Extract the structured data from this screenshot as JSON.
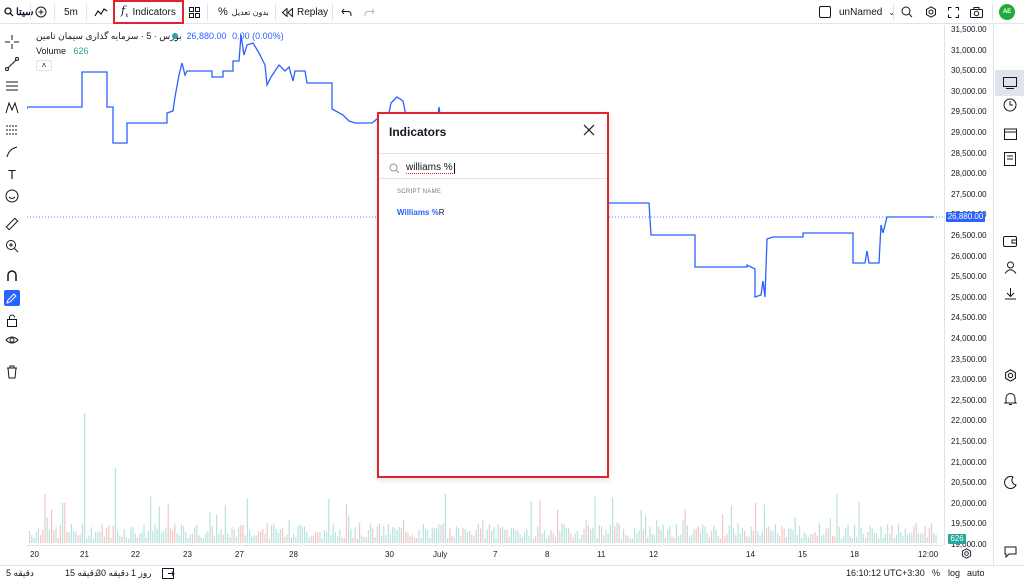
{
  "topbar": {
    "symbol": "سیتا",
    "interval": "5m",
    "indicators_label": "Indicators",
    "adjust_label": "بدون تعدیل",
    "replay_label": "Replay",
    "layout_name": "unNamed",
    "avatar_initials": "AE"
  },
  "legend": {
    "symbol_title": "بورس · 5 · سرمایه گذاری سیمان تامین",
    "price": "26,880.00",
    "change": "0.00 (0.00%)",
    "volume_label": "Volume",
    "volume_value": "626",
    "collapse_icon": "chevron-up-icon"
  },
  "price_axis": {
    "ticks": [
      "31,500.00",
      "31,000.00",
      "30,500.00",
      "30,000.00",
      "29,500.00",
      "29,000.00",
      "28,500.00",
      "28,000.00",
      "27,500.00",
      "27,000.00",
      "26,500.00",
      "26,000.00",
      "25,500.00",
      "25,000.00",
      "24,500.00",
      "24,000.00",
      "23,500.00",
      "23,000.00",
      "22,500.00",
      "22,000.00",
      "21,500.00",
      "21,000.00",
      "20,500.00",
      "20,000.00",
      "19,500.00",
      "19,000.00"
    ],
    "current_price_badge": "26,880.00",
    "volume_badge": "626"
  },
  "time_axis": {
    "ticks": [
      "20",
      "21",
      "22",
      "23",
      "27",
      "28",
      "30",
      "July",
      "7",
      "8",
      "11",
      "12",
      "14",
      "15",
      "18",
      "12:00"
    ]
  },
  "bottombar": {
    "ranges": [
      "5 دقیقه",
      "15 دقیقه",
      "30 دقیقه",
      "1 روز"
    ],
    "clock": "16:10:12 UTC+3:30",
    "percent": "%",
    "log": "log",
    "auto": "auto"
  },
  "modal": {
    "title": "Indicators",
    "search_value": "williams %",
    "section_header": "SCRIPT NAME",
    "result_highlight": "Williams %",
    "result_rest": "R"
  },
  "colors": {
    "line": "#2962ff",
    "highlight": "#e0232e",
    "volume_up": "#26a69a",
    "volume_down": "#ef5350"
  }
}
